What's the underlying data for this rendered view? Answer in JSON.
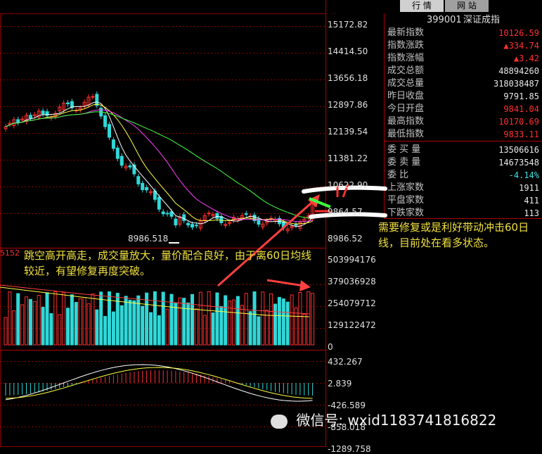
{
  "tabs": {
    "quote": "行 情",
    "web": "网 站"
  },
  "index": {
    "code": "399001",
    "name": "深证成指"
  },
  "stats": [
    {
      "label": "最新指数",
      "value": "10126.59",
      "cls": "red"
    },
    {
      "label": "指数涨跌",
      "value": "▲334.74",
      "cls": "red"
    },
    {
      "label": "指数涨幅",
      "value": "▲3.42",
      "cls": "red"
    },
    {
      "label": "成交总额",
      "value": "48894260",
      "cls": "white"
    },
    {
      "label": "成交总量",
      "value": "318038487",
      "cls": "white"
    },
    {
      "label": "昨日收盘",
      "value": "9791.85",
      "cls": "white"
    },
    {
      "label": "今日开盘",
      "value": "9841.04",
      "cls": "red"
    },
    {
      "label": "最高指数",
      "value": "10170.69",
      "cls": "red"
    },
    {
      "label": "最低指数",
      "value": "9833.11",
      "cls": "red"
    },
    {
      "label": "委 买 量",
      "value": "13506616",
      "cls": "white"
    },
    {
      "label": "委 卖 量",
      "value": "14673548",
      "cls": "white"
    },
    {
      "label": "委  比",
      "value": "-4.14%",
      "cls": "cyan"
    },
    {
      "label": "上涨家数",
      "value": "1911",
      "cls": "white"
    },
    {
      "label": "平盘家数",
      "value": "411",
      "cls": "white"
    },
    {
      "label": "下跌家数",
      "value": "113",
      "cls": "white"
    }
  ],
  "price_axis": [
    "15172.82",
    "14414.50",
    "13656.18",
    "12897.86",
    "12139.54",
    "11381.22",
    "10622.90",
    "9864.57",
    "8986.52"
  ],
  "volume_axis": [
    "503994176",
    "379036928",
    "254079712",
    "129122472",
    "0"
  ],
  "macd_axis": [
    "432.267",
    "2.839",
    "-426.589",
    "-858.018",
    "-1289.758"
  ],
  "low_marker": "8986.518",
  "vol_left_label": "5152",
  "notes": {
    "left": "跳空高开高走，成交量放大，量价配合良好，由于离60日均线较近，有望修复再度突破。",
    "right": "需要修复或是利好带动冲击60日线，目前处在看多状态。"
  },
  "watermark": "微信号: wxid1183741816822",
  "colors": {
    "up": "#ff3030",
    "down": "#30d8d8",
    "grid": "#8b0000",
    "ma5": "#ffffff",
    "ma10": "#ffff40",
    "ma20": "#ff40ff",
    "ma60": "#40ff40"
  }
}
